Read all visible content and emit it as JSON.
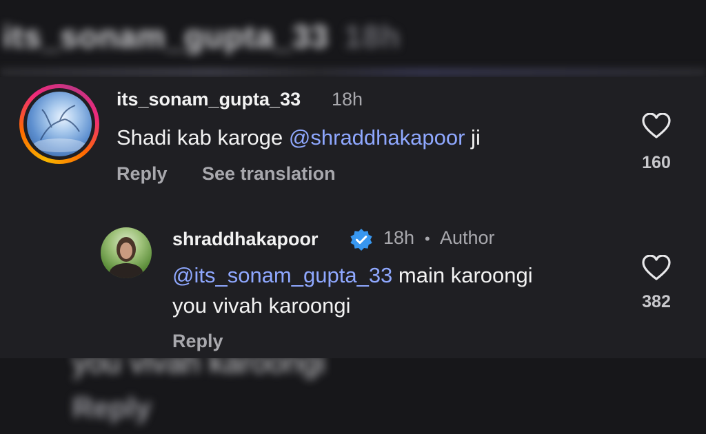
{
  "background_blur": {
    "top_text": "its_sonam_gupta_33",
    "top_time": "18h",
    "bottom_line1": "you vivah karoongi",
    "bottom_line2": "Reply"
  },
  "comment": {
    "username": "its_sonam_gupta_33",
    "time": "18h",
    "text_before": "Shadi kab karoge ",
    "mention": "@shraddhakapoor",
    "text_after": " ji",
    "reply_label": "Reply",
    "translate_label": "See translation",
    "like_count": "160",
    "like_icon": "heart-outline-icon"
  },
  "reply": {
    "username": "shraddhakapoor",
    "verified_icon": "verified-badge-icon",
    "time": "18h",
    "separator": "•",
    "author_label": "Author",
    "mention": "@its_sonam_gupta_33",
    "text_line1": " main karoongi",
    "text_line2": "you vivah karoongi",
    "reply_label": "Reply",
    "like_count": "382",
    "like_icon": "heart-outline-icon"
  },
  "colors": {
    "background": "#1f1f23",
    "mention": "#8fa8ff",
    "verified": "#3897f0",
    "muted": "#a8a8ad"
  }
}
